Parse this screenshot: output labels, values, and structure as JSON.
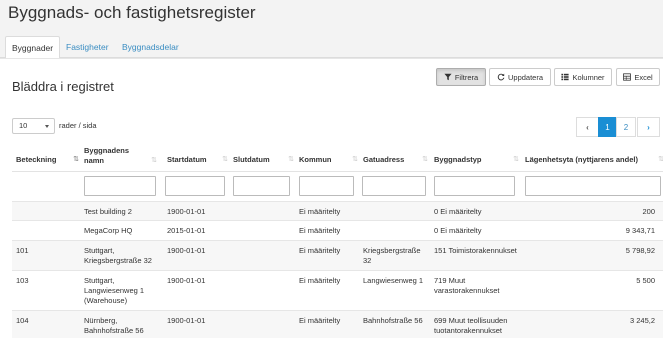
{
  "title": "Byggnads- och fastighetsregister",
  "tabs": [
    {
      "label": "Byggnader"
    },
    {
      "label": "Fastigheter"
    },
    {
      "label": "Byggnadsdelar"
    }
  ],
  "panel_title": "Bläddra i registret",
  "toolbar": {
    "filter": "Filtrera",
    "refresh": "Uppdatera",
    "columns": "Kolumner",
    "excel": "Excel"
  },
  "page_size": "10",
  "rows_per_page_label": "rader / sida",
  "pagination": {
    "prev": "‹",
    "pages": [
      "1",
      "2"
    ],
    "next": "›"
  },
  "columns": [
    "Beteckning",
    "Byggnadens namn",
    "Startdatum",
    "Slutdatum",
    "Kommun",
    "Gatuadress",
    "Byggnadstyp",
    "Lägenhetsyta (nyttjarens andel)"
  ],
  "rows": [
    {
      "id": "",
      "name": "Test building 2",
      "start": "1900-01-01",
      "end": "",
      "municipality": "Ei määritelty",
      "address": "",
      "type": "0 Ei määritelty",
      "area": "200"
    },
    {
      "id": "",
      "name": "MegaCorp HQ",
      "start": "2015-01-01",
      "end": "",
      "municipality": "Ei määritelty",
      "address": "",
      "type": "0 Ei määritelty",
      "area": "9 343,71"
    },
    {
      "id": "101",
      "name": "Stuttgart, Kriegsbergstraße 32",
      "start": "1900-01-01",
      "end": "",
      "municipality": "Ei määritelty",
      "address": "Kriegsbergstraße 32",
      "type": "151 Toimistorakennukset",
      "area": "5 798,92"
    },
    {
      "id": "103",
      "name": "Stuttgart, Langwiesenweg 1 (Warehouse)",
      "start": "1900-01-01",
      "end": "",
      "municipality": "Ei määritelty",
      "address": "Langwiesenweg 1",
      "type": "719 Muut varastorakennukset",
      "area": "5 500"
    },
    {
      "id": "104",
      "name": "Nürnberg, Bahnhofstraße 56",
      "start": "1900-01-01",
      "end": "",
      "municipality": "Ei määritelty",
      "address": "Bahnhofstraße 56",
      "type": "699 Muut teollisuuden tuotantorakennukset",
      "area": "3 245,2"
    }
  ]
}
